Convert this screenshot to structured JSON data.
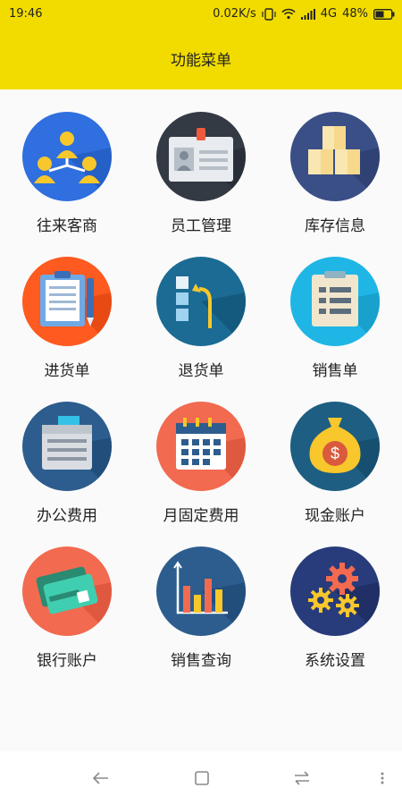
{
  "status": {
    "time": "19:46",
    "speed": "0.02K/s",
    "network": "4G",
    "battery": "48%"
  },
  "header": {
    "title": "功能菜单"
  },
  "menu": [
    {
      "label": "往来客商",
      "icon": "contacts-icon",
      "color": "#2f6fdf"
    },
    {
      "label": "员工管理",
      "icon": "id-card-icon",
      "color": "#333a44"
    },
    {
      "label": "库存信息",
      "icon": "boxes-icon",
      "color": "#3b4f87"
    },
    {
      "label": "进货单",
      "icon": "clipboard-pen-icon",
      "color": "#ff5a1f"
    },
    {
      "label": "退货单",
      "icon": "return-arrow-icon",
      "color": "#1b6b94"
    },
    {
      "label": "销售单",
      "icon": "notepad-icon",
      "color": "#1fb6e6"
    },
    {
      "label": "办公费用",
      "icon": "printer-icon",
      "color": "#2c5d8e"
    },
    {
      "label": "月固定费用",
      "icon": "calendar-icon",
      "color": "#f26a50"
    },
    {
      "label": "现金账户",
      "icon": "money-bag-icon",
      "color": "#1d5e82"
    },
    {
      "label": "银行账户",
      "icon": "bank-card-icon",
      "color": "#f26a50"
    },
    {
      "label": "销售查询",
      "icon": "bar-chart-icon",
      "color": "#2c5d8e"
    },
    {
      "label": "系统设置",
      "icon": "gears-icon",
      "color": "#283b7a"
    }
  ]
}
